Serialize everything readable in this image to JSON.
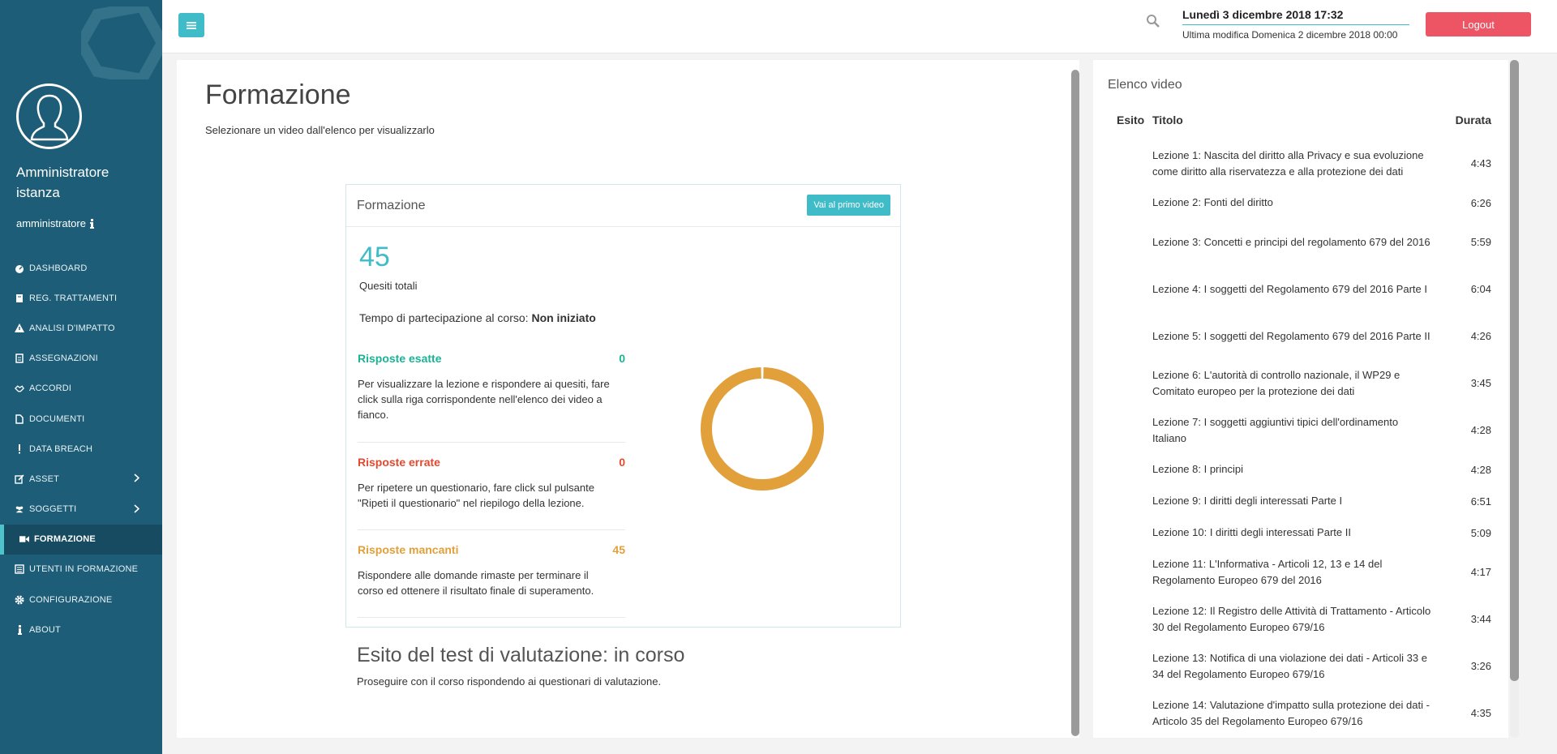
{
  "sidebar": {
    "profile_name": "Amministratore istanza",
    "profile_user": "amministratore",
    "items": [
      {
        "label": "DASHBOARD",
        "icon": "dashboard-icon"
      },
      {
        "label": "REG. TRATTAMENTI",
        "icon": "book-icon"
      },
      {
        "label": "ANALISI D'IMPATTO",
        "icon": "warning-icon"
      },
      {
        "label": "ASSEGNAZIONI",
        "icon": "document-icon"
      },
      {
        "label": "ACCORDI",
        "icon": "handshake-icon"
      },
      {
        "label": "DOCUMENTI",
        "icon": "file-icon"
      },
      {
        "label": "DATA BREACH",
        "icon": "exclamation-icon"
      },
      {
        "label": "ASSET",
        "icon": "edit-icon"
      },
      {
        "label": "SOGGETTI",
        "icon": "users-icon"
      },
      {
        "label": "FORMAZIONE",
        "icon": "video-icon"
      },
      {
        "label": "UTENTI IN FORMAZIONE",
        "icon": "list-icon"
      },
      {
        "label": "CONFIGURAZIONE",
        "icon": "gear-icon"
      },
      {
        "label": "ABOUT",
        "icon": "info-icon"
      }
    ]
  },
  "topbar": {
    "date_main": "Lunedì 3 dicembre 2018 17:32",
    "date_sub": "Ultima modifica Domenica 2 dicembre 2018 00:00",
    "logout_label": "Logout"
  },
  "main": {
    "title": "Formazione",
    "subtitle": "Selezionare un video dall'elenco per visualizzarlo",
    "card": {
      "title": "Formazione",
      "button_label": "Vai al primo video",
      "total": "45",
      "total_label": "Quesiti totali",
      "time_label": "Tempo di partecipazione al corso: ",
      "time_value": "Non iniziato",
      "stats": [
        {
          "label": "Risposte esatte",
          "value": "0",
          "desc": "Per visualizzare la lezione e rispondere ai quesiti, fare click sulla riga corrispondente nell'elenco dei video a fianco."
        },
        {
          "label": "Risposte errate",
          "value": "0",
          "desc": "Per ripetere un questionario, fare click sul pulsante \"Ripeti il questionario\" nel riepilogo della lezione."
        },
        {
          "label": "Risposte mancanti",
          "value": "45",
          "desc": "Rispondere alle domande rimaste per terminare il corso ed ottenere il risultato finale di superamento."
        }
      ]
    },
    "esito_title": "Esito del test di valutazione: in corso",
    "esito_sub": "Proseguire con il corso rispondendo ai questionari di valutazione."
  },
  "colors": {
    "sidebar": "#1d5d77",
    "accent": "#3fbcc8",
    "logout": "#ed5565",
    "correct": "#1ab394",
    "wrong": "#e24a2f",
    "missing": "#e2a03a"
  },
  "chart_data": {
    "type": "pie",
    "categories": [
      "Risposte esatte",
      "Risposte errate",
      "Risposte mancanti"
    ],
    "values": [
      0,
      0,
      45
    ]
  },
  "videos": {
    "title": "Elenco video",
    "columns": [
      "Esito",
      "Titolo",
      "Durata"
    ],
    "rows": [
      {
        "title": "Lezione 1: Nascita del diritto alla Privacy e sua evoluzione come diritto alla riservatezza e alla protezione dei dati",
        "duration": "4:43"
      },
      {
        "title": "Lezione 2: Fonti del diritto",
        "duration": "6:26"
      },
      {
        "title": "Lezione 3: Concetti e principi del regolamento 679 del 2016",
        "duration": "5:59"
      },
      {
        "title": "Lezione 4: I soggetti del Regolamento 679 del 2016 Parte I",
        "duration": "6:04"
      },
      {
        "title": "Lezione 5: I soggetti del Regolamento 679 del 2016 Parte II",
        "duration": "4:26"
      },
      {
        "title": "Lezione 6: L'autorità di controllo nazionale, il WP29 e Comitato europeo per la protezione dei dati",
        "duration": "3:45"
      },
      {
        "title": "Lezione 7: I soggetti aggiuntivi tipici dell'ordinamento Italiano",
        "duration": "4:28"
      },
      {
        "title": "Lezione 8: I principi",
        "duration": "4:28"
      },
      {
        "title": "Lezione 9: I diritti degli interessati Parte I",
        "duration": "6:51"
      },
      {
        "title": "Lezione 10: I diritti degli interessati Parte II",
        "duration": "5:09"
      },
      {
        "title": "Lezione 11: L'Informativa - Articoli 12, 13 e 14 del Regolamento Europeo 679 del 2016",
        "duration": "4:17"
      },
      {
        "title": "Lezione 12: Il Registro delle Attività di Trattamento - Articolo 30 del Regolamento Europeo 679/16",
        "duration": "3:44"
      },
      {
        "title": "Lezione 13: Notifica di una violazione dei dati - Articoli 33 e 34 del Regolamento Europeo 679/16",
        "duration": "3:26"
      },
      {
        "title": "Lezione 14: Valutazione d'impatto sulla protezione dei dati - Articolo 35 del Regolamento Europeo 679/16",
        "duration": "4:35"
      }
    ]
  }
}
